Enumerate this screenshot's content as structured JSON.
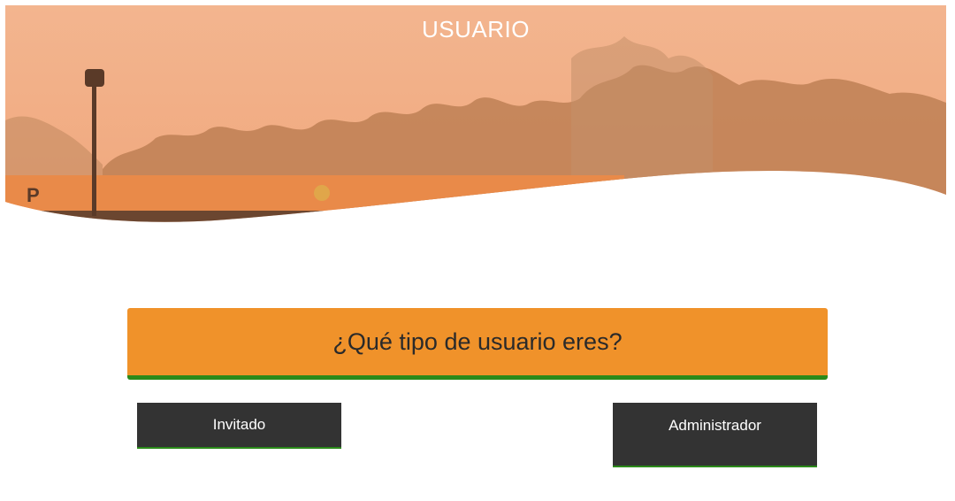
{
  "hero": {
    "title": "USUARIO",
    "sign_letter": "P"
  },
  "question": {
    "text": "¿Qué tipo de usuario eres?"
  },
  "buttons": {
    "guest_label": "Invitado",
    "admin_label": "Administrador"
  },
  "colors": {
    "accent_orange": "#f0922a",
    "underline_green": "#2b8a1a",
    "button_dark": "#333333"
  }
}
